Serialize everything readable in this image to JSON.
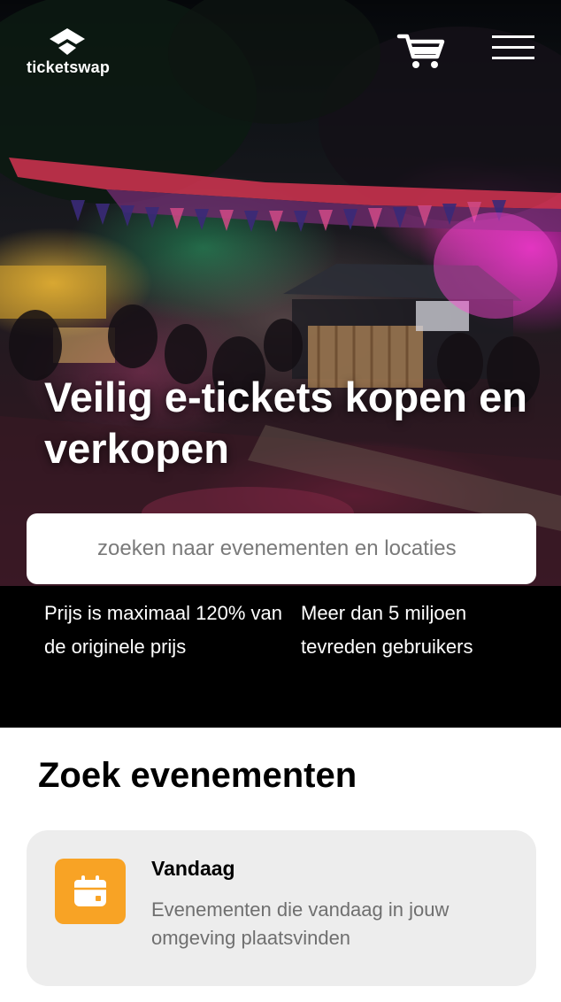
{
  "header": {
    "logo_text": "ticketswap",
    "icons": {
      "logo": "ticketswap-logo-icon",
      "cart": "cart-icon",
      "menu": "hamburger-menu-icon"
    }
  },
  "hero": {
    "headline": "Veilig e-tickets kopen en verkopen"
  },
  "search": {
    "placeholder": "zoeken naar evenementen en locaties"
  },
  "usps": [
    {
      "text": "Prijs is maximaal 120% van de originele prijs"
    },
    {
      "text": "Meer dan 5 miljoen tevreden gebruikers"
    }
  ],
  "events_section": {
    "title": "Zoek evenementen",
    "cards": [
      {
        "title": "Vandaag",
        "description": "Evenementen die vandaag in jouw omgeving plaatsvinden",
        "icon": "calendar-icon"
      }
    ]
  },
  "colors": {
    "brand_white": "#ffffff",
    "band_black": "#000000",
    "card_background": "#ededed",
    "calendar_orange": "#f8a325",
    "muted_text": "#6f6f6f"
  }
}
